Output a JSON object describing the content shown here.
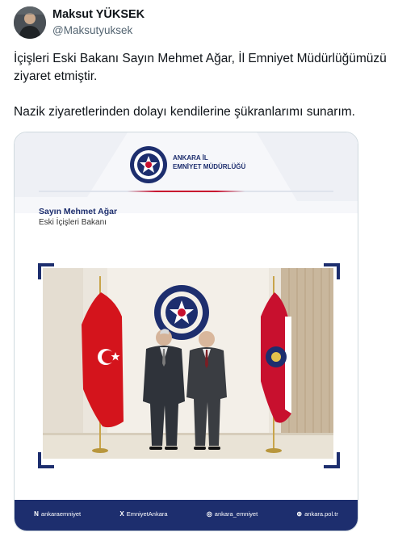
{
  "author": {
    "name": "Maksut YÜKSEK",
    "handle": "@Maksutyuksek"
  },
  "tweet": {
    "paragraph1": "İçişleri Eski Bakanı Sayın Mehmet Ağar, İl Emniyet Müdürlüğümüzü ziyaret etmiştir.",
    "paragraph2": "Nazik ziyaretlerinden dolayı kendilerine şükranlarımı sunarım."
  },
  "card": {
    "org_line1": "ANKARA İL",
    "org_line2": "EMNİYET MÜDÜRLÜĞÜ",
    "visitor_name": "Sayın Mehmet Ağar",
    "visitor_title": "Eski İçişleri Bakanı",
    "footer": [
      {
        "icon": "N",
        "label": "ankaraemniyet"
      },
      {
        "icon": "X",
        "label": "EmniyetAnkara"
      },
      {
        "icon": "◎",
        "label": "ankara_emniyet"
      },
      {
        "icon": "⊕",
        "label": "ankara.pol.tr"
      }
    ]
  },
  "colors": {
    "navy": "#1d2e6e",
    "red": "#c8102e",
    "handle_gray": "#536471"
  }
}
